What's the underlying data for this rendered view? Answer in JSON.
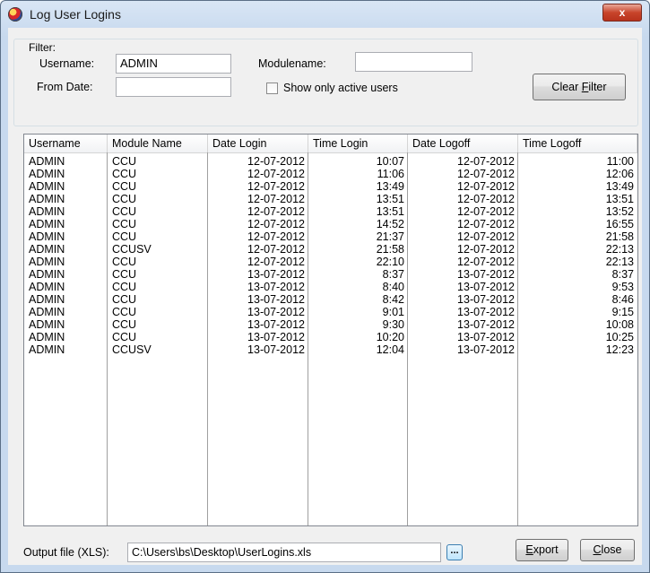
{
  "window": {
    "title": "Log User Logins",
    "close_glyph": "x"
  },
  "filter": {
    "group_label": "Filter:",
    "username_label": "Username:",
    "username_value": "ADMIN",
    "modulename_label": "Modulename:",
    "modulename_value": "",
    "fromdate_label": "From Date:",
    "fromdate_value": "",
    "active_only_label": "Show only active users",
    "active_only_checked": false,
    "clear_button_label": "Clear Filter"
  },
  "table": {
    "columns": [
      "Username",
      "Module Name",
      "Date Login",
      "Time Login",
      "Date Logoff",
      "Time Logoff"
    ],
    "rows": [
      [
        "ADMIN",
        "CCU",
        "12-07-2012",
        "10:07",
        "12-07-2012",
        "11:00"
      ],
      [
        "ADMIN",
        "CCU",
        "12-07-2012",
        "11:06",
        "12-07-2012",
        "12:06"
      ],
      [
        "ADMIN",
        "CCU",
        "12-07-2012",
        "13:49",
        "12-07-2012",
        "13:49"
      ],
      [
        "ADMIN",
        "CCU",
        "12-07-2012",
        "13:51",
        "12-07-2012",
        "13:51"
      ],
      [
        "ADMIN",
        "CCU",
        "12-07-2012",
        "13:51",
        "12-07-2012",
        "13:52"
      ],
      [
        "ADMIN",
        "CCU",
        "12-07-2012",
        "14:52",
        "12-07-2012",
        "16:55"
      ],
      [
        "ADMIN",
        "CCU",
        "12-07-2012",
        "21:37",
        "12-07-2012",
        "21:58"
      ],
      [
        "ADMIN",
        "CCUSV",
        "12-07-2012",
        "21:58",
        "12-07-2012",
        "22:13"
      ],
      [
        "ADMIN",
        "CCU",
        "12-07-2012",
        "22:10",
        "12-07-2012",
        "22:13"
      ],
      [
        "ADMIN",
        "CCU",
        "13-07-2012",
        "8:37",
        "13-07-2012",
        "8:37"
      ],
      [
        "ADMIN",
        "CCU",
        "13-07-2012",
        "8:40",
        "13-07-2012",
        "9:53"
      ],
      [
        "ADMIN",
        "CCU",
        "13-07-2012",
        "8:42",
        "13-07-2012",
        "8:46"
      ],
      [
        "ADMIN",
        "CCU",
        "13-07-2012",
        "9:01",
        "13-07-2012",
        "9:15"
      ],
      [
        "ADMIN",
        "CCU",
        "13-07-2012",
        "9:30",
        "13-07-2012",
        "10:08"
      ],
      [
        "ADMIN",
        "CCU",
        "13-07-2012",
        "10:20",
        "13-07-2012",
        "10:25"
      ],
      [
        "ADMIN",
        "CCUSV",
        "13-07-2012",
        "12:04",
        "13-07-2012",
        "12:23"
      ]
    ]
  },
  "footer": {
    "output_label": "Output file (XLS):",
    "output_value": "C:\\Users\\bs\\Desktop\\UserLogins.xls",
    "browse_glyph": "...",
    "export_label": "Export",
    "close_label": "Close"
  }
}
